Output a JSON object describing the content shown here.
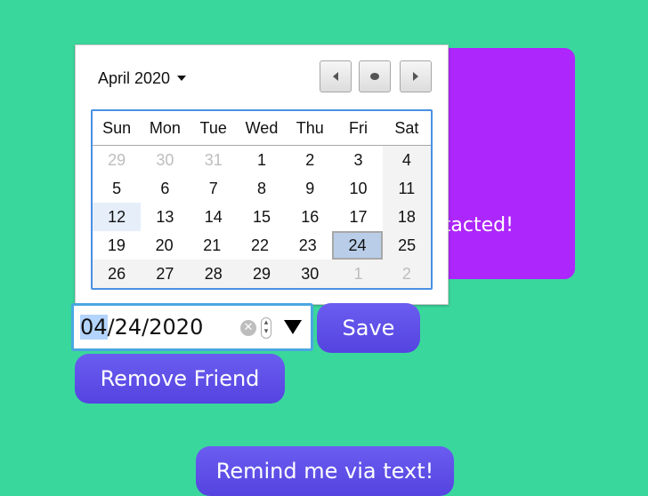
{
  "card": {
    "text": "Contacted!"
  },
  "calendar": {
    "month_label": "April 2020",
    "weekdays": [
      "Sun",
      "Mon",
      "Tue",
      "Wed",
      "Thu",
      "Fri",
      "Sat"
    ],
    "weeks": [
      [
        "29",
        "30",
        "31",
        "1",
        "2",
        "3",
        "4"
      ],
      [
        "5",
        "6",
        "7",
        "8",
        "9",
        "10",
        "11"
      ],
      [
        "12",
        "13",
        "14",
        "15",
        "16",
        "17",
        "18"
      ],
      [
        "19",
        "20",
        "21",
        "22",
        "23",
        "24",
        "25"
      ],
      [
        "26",
        "27",
        "28",
        "29",
        "30",
        "1",
        "2"
      ]
    ],
    "today": "12",
    "selected": "24",
    "prev_icon": "triangle-left",
    "today_icon": "dot",
    "next_icon": "triangle-right"
  },
  "date_input": {
    "month": "04",
    "rest": "/24/2020"
  },
  "buttons": {
    "save": "Save",
    "remove_friend": "Remove Friend",
    "remind_text": "Remind me via text!"
  },
  "colors": {
    "background": "#3ad79c",
    "card": "#ad26fb",
    "button": "#5a4be6",
    "focus": "#4a90e2"
  }
}
